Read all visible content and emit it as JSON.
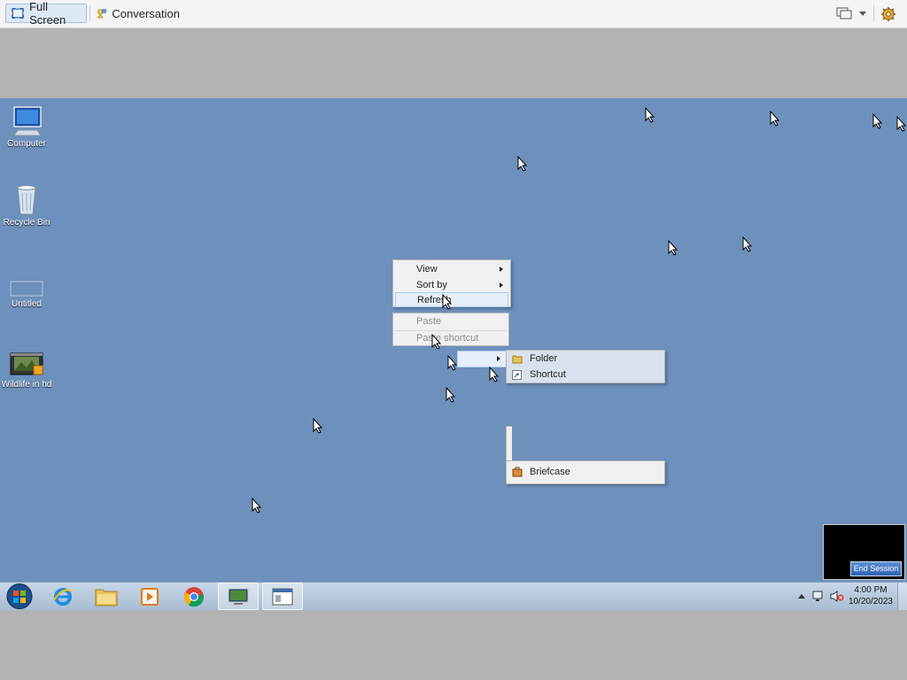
{
  "toolbar": {
    "full_screen_label": "Full Screen",
    "conversation_label": "Conversation"
  },
  "desktop": {
    "icons": [
      {
        "label": "Computer",
        "icon": "computer-icon"
      },
      {
        "label": "Recycle Bin",
        "icon": "recycle-bin-icon"
      },
      {
        "label": "Untitled",
        "icon": "blank-file-icon"
      },
      {
        "label": "Wildlife in hd",
        "icon": "video-file-icon"
      }
    ]
  },
  "context_menu": {
    "items": [
      {
        "label": "View",
        "submenu": true
      },
      {
        "label": "Sort by",
        "submenu": true
      },
      {
        "label": "Refresh",
        "highlighted": true
      },
      {
        "label": "Paste",
        "disabled": true
      },
      {
        "label": "Paste shortcut",
        "disabled": true
      }
    ]
  },
  "new_submenu": {
    "items": [
      {
        "label": "Folder",
        "icon": "folder-icon"
      },
      {
        "label": "Shortcut",
        "icon": "shortcut-icon"
      }
    ],
    "bottom_items": [
      {
        "label": "Briefcase",
        "icon": "briefcase-icon"
      }
    ]
  },
  "session": {
    "end_session_label": "End Session"
  },
  "taskbar": {
    "time": "4:00 PM",
    "date": "10/20/2023"
  },
  "colors": {
    "desktop_bg": "#6d90bd",
    "highlight_bg": "#e5eef9"
  }
}
